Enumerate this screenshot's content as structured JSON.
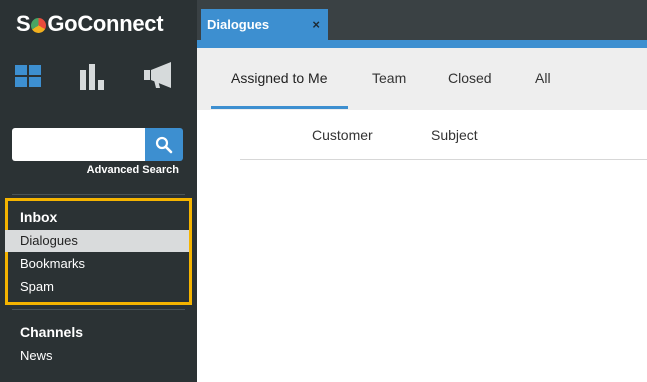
{
  "app": {
    "logo_parts": [
      "S",
      "GoConnect"
    ],
    "logo_colors": [
      "#e94b3c",
      "#f2b01e",
      "#4aa564"
    ],
    "accent": "#3d8fd0",
    "highlight_border": "#f5b400"
  },
  "sidebar": {
    "nav_icons": [
      "dashboard-grid-icon",
      "bar-chart-icon",
      "megaphone-icon"
    ],
    "search": {
      "placeholder": "",
      "value": "",
      "advanced_label": "Advanced Search"
    },
    "inbox": {
      "title": "Inbox",
      "items": [
        {
          "label": "Dialogues",
          "active": true
        },
        {
          "label": "Bookmarks",
          "active": false
        },
        {
          "label": "Spam",
          "active": false
        }
      ]
    },
    "channels": {
      "title": "Channels",
      "items": [
        {
          "label": "News"
        }
      ]
    }
  },
  "main": {
    "tab": {
      "label": "Dialogues",
      "close_glyph": "×"
    },
    "subtabs": [
      {
        "label": "Assigned to Me",
        "active": true
      },
      {
        "label": "Team",
        "active": false
      },
      {
        "label": "Closed",
        "active": false
      },
      {
        "label": "All",
        "active": false
      }
    ],
    "columns": [
      "Customer",
      "Subject"
    ]
  }
}
